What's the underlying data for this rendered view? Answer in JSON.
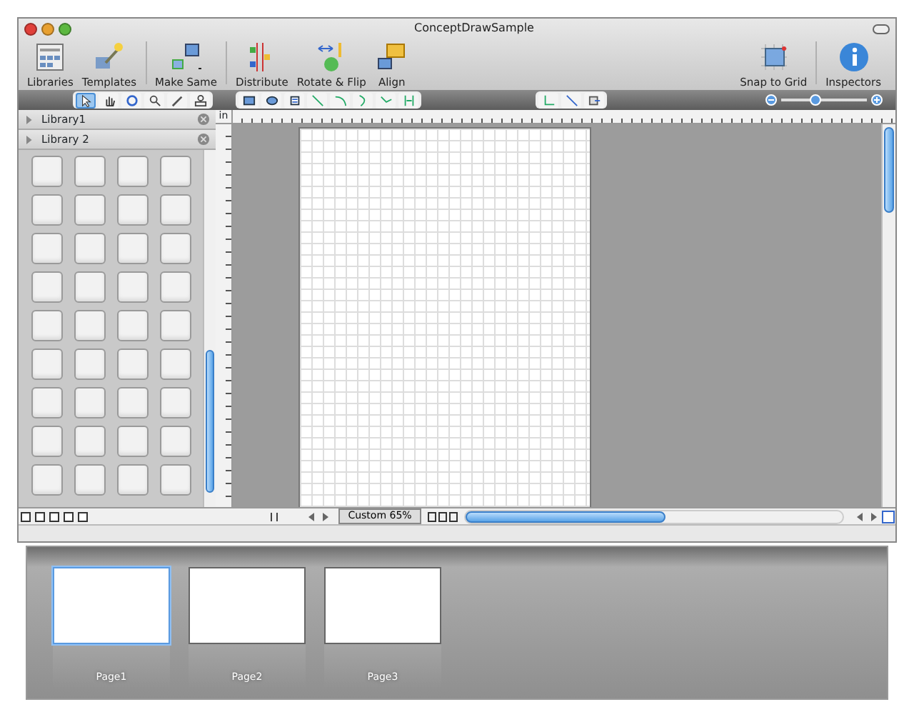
{
  "window": {
    "title": "ConceptDrawSample"
  },
  "toolbar": [
    {
      "kind": "libraries",
      "label": "Libraries"
    },
    {
      "kind": "templates",
      "label": "Templates"
    },
    {
      "kind": "make-same",
      "label": "Make Same"
    },
    {
      "kind": "distribute",
      "label": "Distribute"
    },
    {
      "kind": "rotate",
      "label": "Rotate & Flip"
    },
    {
      "kind": "align",
      "label": "Align"
    },
    {
      "kind": "snap",
      "label": "Snap to Grid"
    },
    {
      "kind": "inspectors",
      "label": "Inspectors"
    }
  ],
  "tool_groups": [
    [
      {
        "kind": "pointer",
        "selected": true
      },
      {
        "kind": "hand",
        "selected": false
      },
      {
        "kind": "rotate",
        "selected": false
      },
      {
        "kind": "zoom",
        "selected": false
      },
      {
        "kind": "pen",
        "selected": false
      },
      {
        "kind": "stamp",
        "selected": false
      }
    ],
    [
      {
        "kind": "rect",
        "selected": false
      },
      {
        "kind": "ellipse",
        "selected": false
      },
      {
        "kind": "text",
        "selected": false
      },
      {
        "kind": "line",
        "selected": false
      },
      {
        "kind": "arc",
        "selected": false
      },
      {
        "kind": "curve",
        "selected": false
      },
      {
        "kind": "polyline",
        "selected": false
      },
      {
        "kind": "connect",
        "selected": false
      }
    ],
    [
      {
        "kind": "elbow",
        "selected": false
      },
      {
        "kind": "direct",
        "selected": false
      },
      {
        "kind": "export",
        "selected": false
      }
    ]
  ],
  "zoom_slider": {
    "level": 0.4
  },
  "libraries": [
    {
      "name": "Library1",
      "expanded": false
    },
    {
      "name": "Library 2",
      "expanded": false
    }
  ],
  "ruler_unit": "in",
  "view_tab": "Custom 65%",
  "pages": [
    {
      "label": "Page1",
      "selected": true
    },
    {
      "label": "Page2",
      "selected": false
    },
    {
      "label": "Page3",
      "selected": false
    }
  ]
}
